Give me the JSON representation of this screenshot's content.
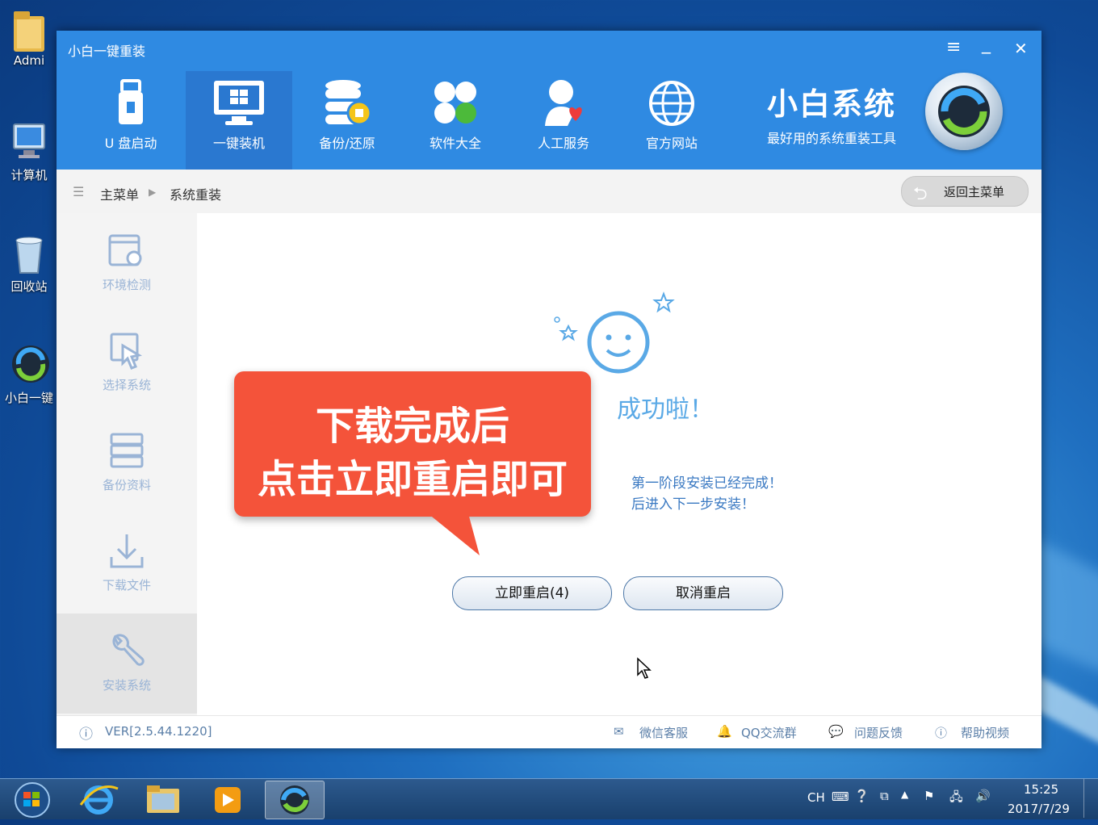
{
  "desktop": {
    "icons": [
      {
        "label": "Admi",
        "icon": "folder-icon"
      },
      {
        "label": "计算机",
        "icon": "computer-icon"
      },
      {
        "label": "回收站",
        "icon": "recycle-bin-icon"
      },
      {
        "label": "小白一键",
        "icon": "xiaobai-app-icon"
      }
    ]
  },
  "window": {
    "title": "小白一键重装",
    "controls": {
      "menu": "≡",
      "minimize": "_",
      "close": "✕"
    },
    "nav": [
      {
        "label": "U 盘启动",
        "icon": "usb-drive-icon"
      },
      {
        "label": "一键装机",
        "icon": "monitor-windows-icon",
        "active": true
      },
      {
        "label": "备份/还原",
        "icon": "database-backup-icon"
      },
      {
        "label": "软件大全",
        "icon": "apps-grid-icon"
      },
      {
        "label": "人工服务",
        "icon": "person-heart-icon"
      },
      {
        "label": "官方网站",
        "icon": "globe-icon"
      }
    ],
    "brand": {
      "title": "小白系统",
      "subtitle": "最好用的系统重装工具"
    },
    "breadcrumb": {
      "home": "主菜单",
      "current": "系统重装",
      "back_label": "返回主菜单"
    },
    "sidebar": [
      {
        "label": "环境检测",
        "icon": "environment-check-icon"
      },
      {
        "label": "选择系统",
        "icon": "cursor-select-icon"
      },
      {
        "label": "备份资料",
        "icon": "server-backup-icon"
      },
      {
        "label": "下载文件",
        "icon": "download-icon"
      },
      {
        "label": "安装系统",
        "icon": "wrench-install-icon",
        "active": true
      }
    ],
    "main": {
      "success_text": "成功啦！",
      "message_line1": "第一阶段安装已经完成！",
      "message_line2": "后进入下一步安装！",
      "restart_button": "立即重启(4)",
      "cancel_button": "取消重启"
    },
    "callout": {
      "line1": "下载完成后",
      "line2": "点击立即重启即可"
    },
    "footer": {
      "version": "VER[2.5.44.1220]",
      "links": [
        "微信客服",
        "QQ交流群",
        "问题反馈",
        "帮助视频"
      ]
    }
  },
  "taskbar": {
    "lang": "CH",
    "time": "15:25",
    "date": "2017/7/29"
  },
  "colors": {
    "header": "#2f8ae2",
    "accent": "#f4533a",
    "sidebar_text": "#9ab4d6"
  }
}
